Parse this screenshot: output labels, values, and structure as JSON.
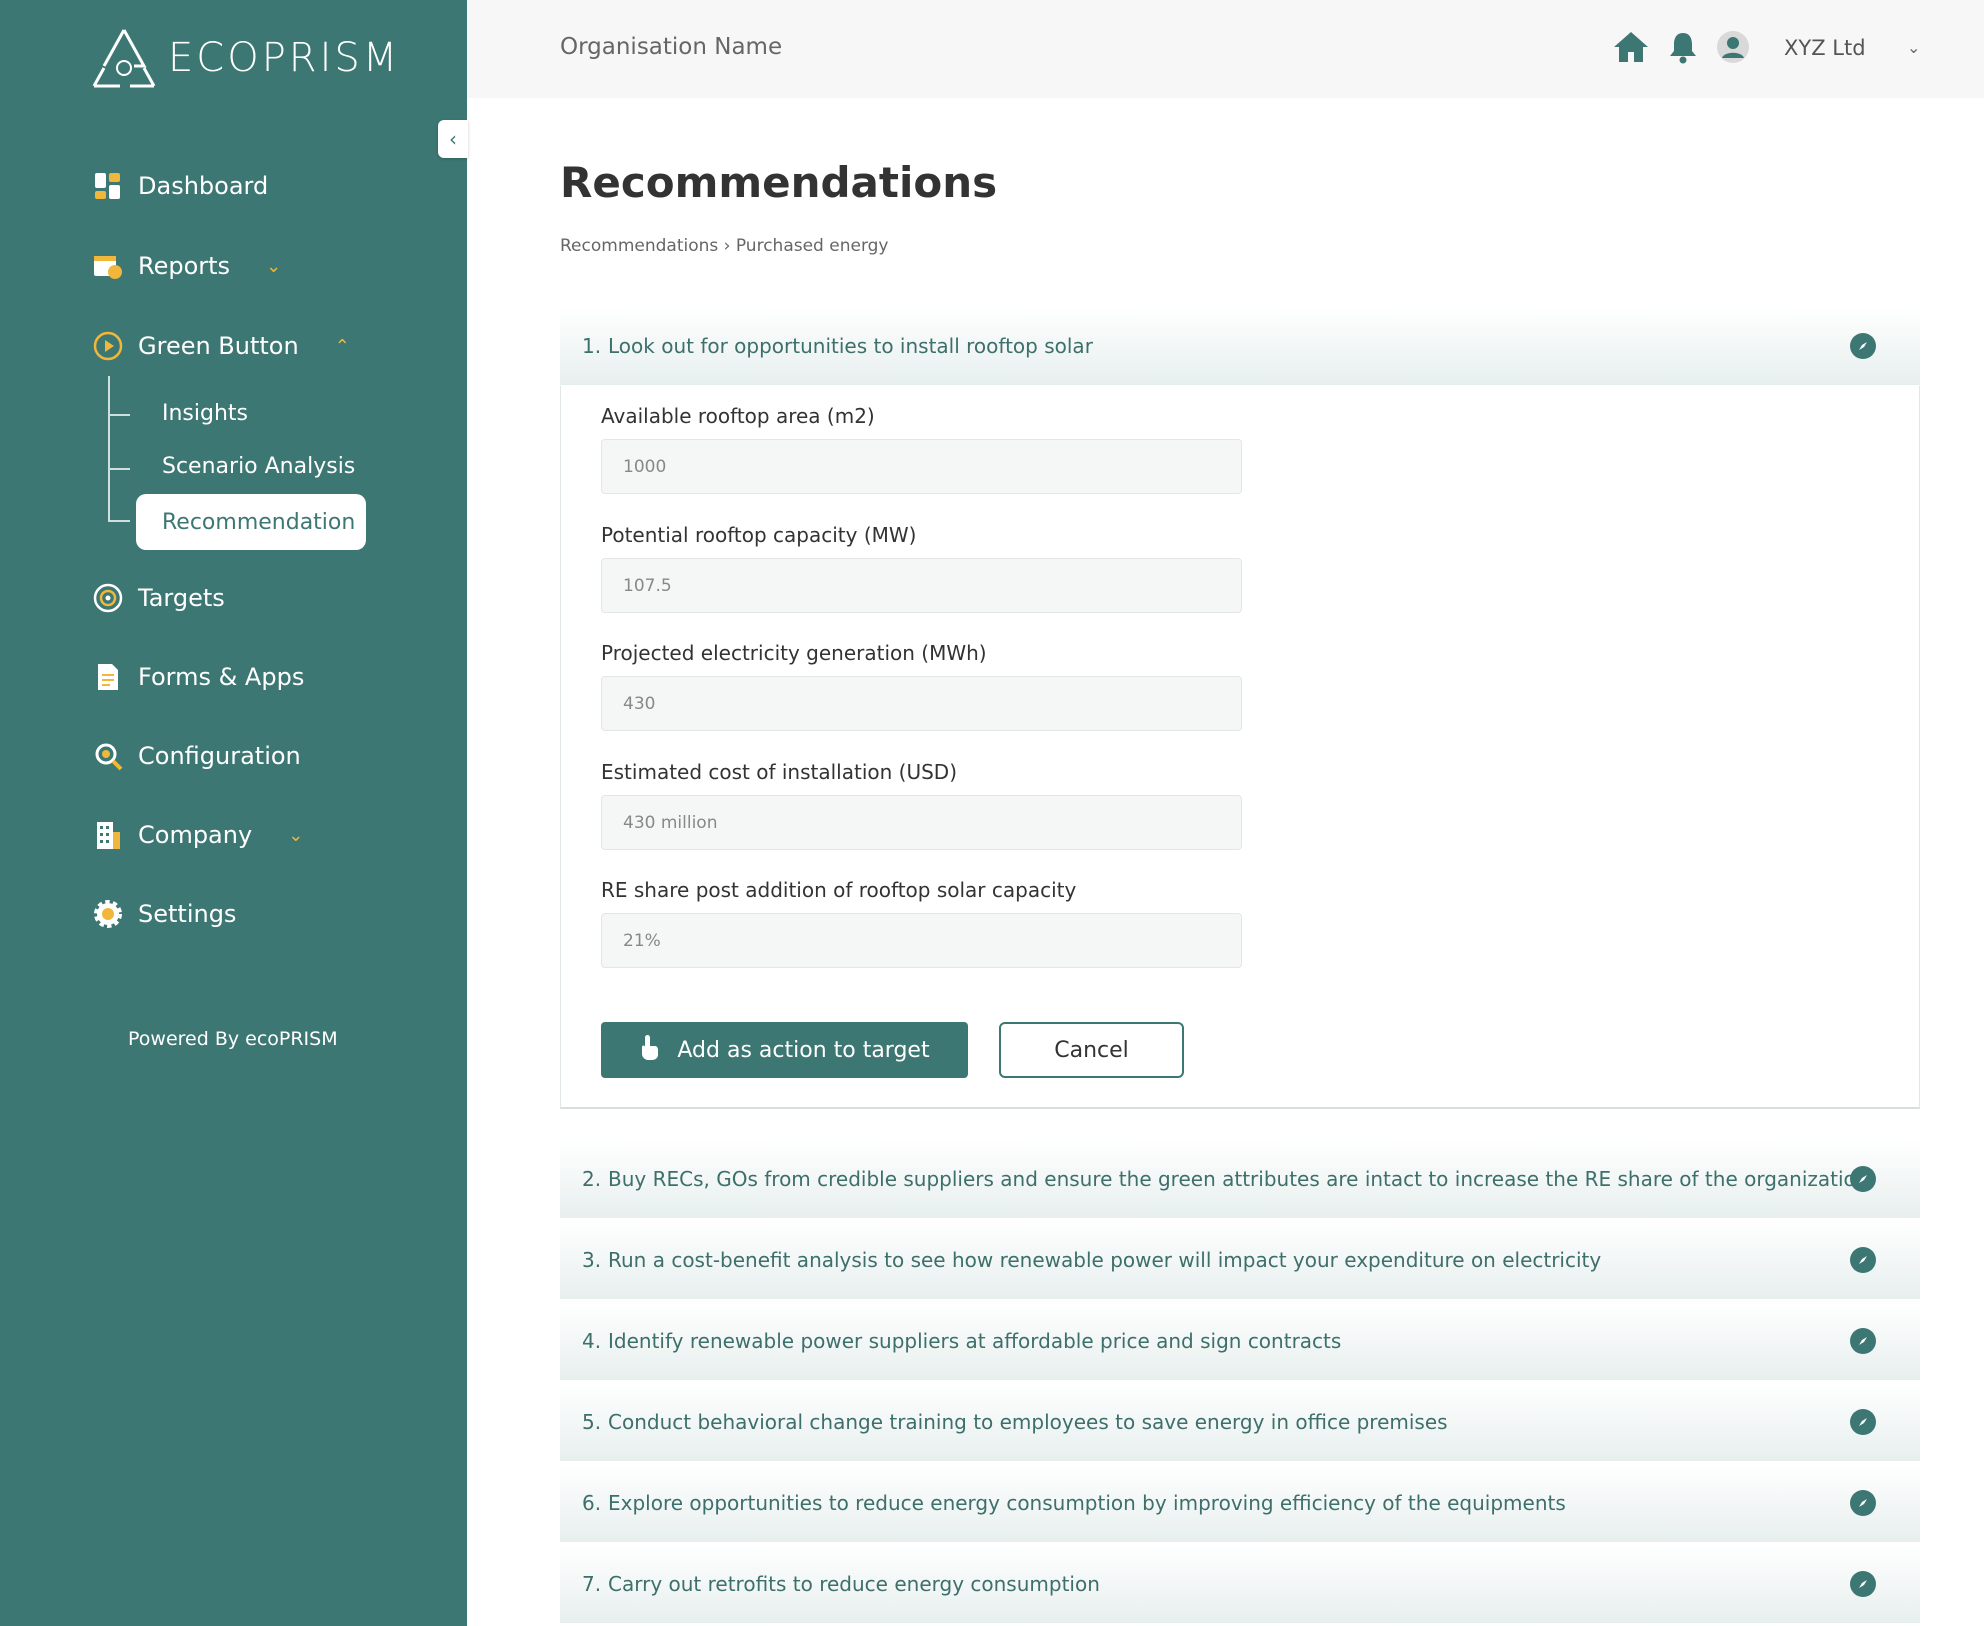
{
  "app": {
    "logo_text": "ECOPRISM"
  },
  "sidebar": {
    "items": [
      {
        "label": "Dashboard",
        "icon": "dashboard-icon"
      },
      {
        "label": "Reports",
        "icon": "reports-icon"
      },
      {
        "label": "Green Button",
        "icon": "play-circle-icon"
      },
      {
        "label": "Targets",
        "icon": "target-icon"
      },
      {
        "label": "Forms & Apps",
        "icon": "form-icon"
      },
      {
        "label": "Configuration",
        "icon": "configuration-icon"
      },
      {
        "label": "Company",
        "icon": "building-icon"
      },
      {
        "label": "Settings",
        "icon": "gear-icon"
      }
    ],
    "sub_items": [
      {
        "label": "Insights"
      },
      {
        "label": "Scenario Analysis"
      },
      {
        "label": "Recommendation"
      }
    ],
    "powered_by": "Powered By ecoPRISM"
  },
  "header": {
    "org_name": "Organisation Name",
    "company": "XYZ Ltd"
  },
  "main": {
    "title": "Recommendations",
    "breadcrumb": [
      "Recommendations",
      "Purchased energy"
    ],
    "expanded": {
      "num": "1.",
      "title": "Look out for opportunities to install rooftop solar",
      "fields": [
        {
          "label": "Available rooftop area (m2)",
          "value": "1000"
        },
        {
          "label": "Potential rooftop capacity (MW)",
          "value": "107.5"
        },
        {
          "label": "Projected electricity generation (MWh)",
          "value": "430"
        },
        {
          "label": "Estimated cost of installation (USD)",
          "value": "430 million"
        },
        {
          "label": "RE share post addition of rooftop solar capacity",
          "value": "21%"
        }
      ],
      "primary_button": "Add as action to target",
      "cancel_button": "Cancel"
    },
    "recommendations": [
      {
        "num": "2.",
        "text": "Buy RECs, GOs from credible suppliers and ensure the green attributes are intact to increase the RE share of the organization"
      },
      {
        "num": "3.",
        "text": "Run a cost-benefit analysis to see how renewable power will impact your expenditure on electricity"
      },
      {
        "num": "4.",
        "text": "Identify renewable power suppliers at affordable price and sign contracts"
      },
      {
        "num": "5.",
        "text": "Conduct behavioral change training to employees to save energy in office premises"
      },
      {
        "num": "6.",
        "text": "Explore opportunities to reduce energy consumption by improving efficiency of the equipments"
      },
      {
        "num": "7.",
        "text": "Carry out retrofits to reduce energy consumption"
      }
    ]
  },
  "colors": {
    "sidebar": "#3d7773",
    "accent": "#f0b73a",
    "primary": "#3d7773"
  }
}
